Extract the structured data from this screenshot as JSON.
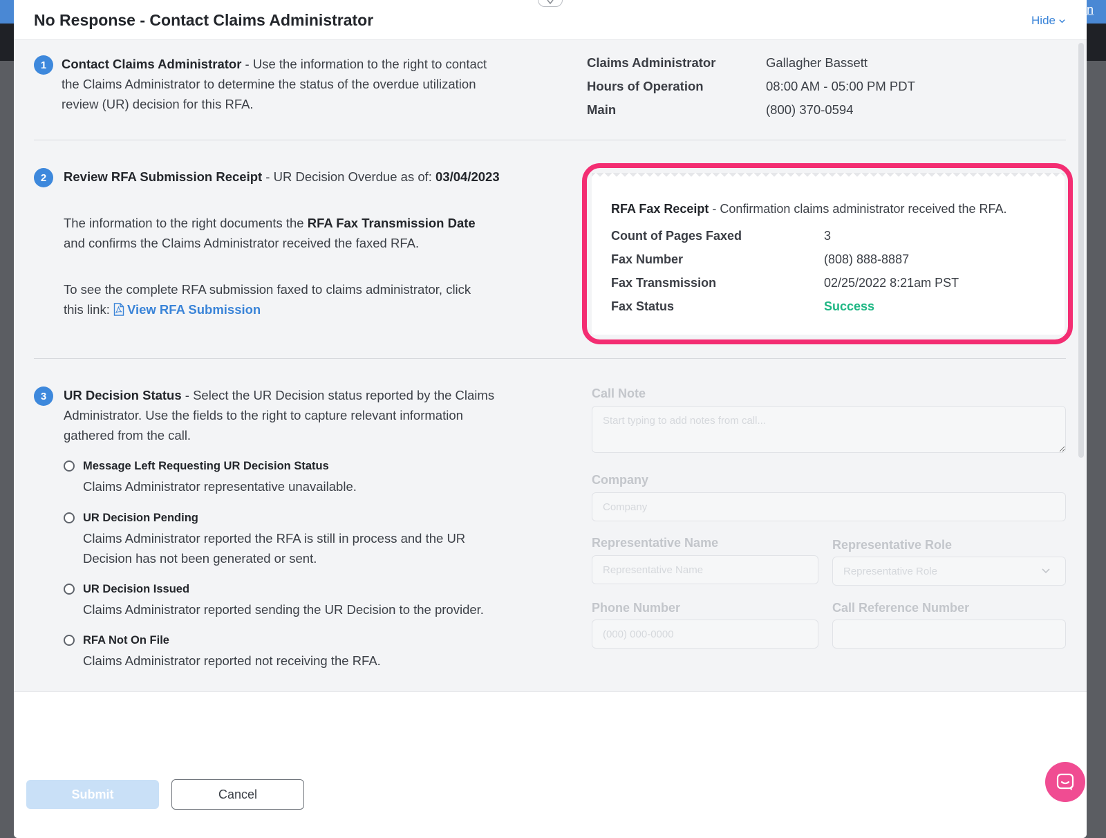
{
  "background": {
    "corner_link": "n"
  },
  "modal": {
    "title": "No Response - Contact Claims Administrator",
    "hide_label": "Hide"
  },
  "step1": {
    "number": "1",
    "heading": "Contact Claims Administrator",
    "text_line1": " - Use the information to the right to contact",
    "text_line2": "the Claims Administrator to determine the status of the overdue utilization",
    "text_line3": "review (UR) decision for this RFA.",
    "info": [
      {
        "label": "Claims Administrator",
        "value": "Gallagher Bassett"
      },
      {
        "label": "Hours of Operation",
        "value": "08:00 AM - 05:00 PM PDT"
      },
      {
        "label": "Main",
        "value": "(800) 370-0594"
      }
    ]
  },
  "step2": {
    "number": "2",
    "heading": "Review RFA Submission Receipt",
    "overdue_prefix": " - UR Decision Overdue as of: ",
    "overdue_date": "03/04/2023",
    "p1_a": "The information to the right documents the ",
    "p1_b": "RFA Fax Transmission Date",
    "p1_c": "and confirms the Claims Administrator received the faxed RFA.",
    "p2_a": "To see the complete RFA submission faxed to claims administrator, click",
    "p2_b": "this link: ",
    "link_label": "View RFA Submission",
    "receipt": {
      "title": "RFA Fax Receipt",
      "subtitle": " - Confirmation claims administrator received the RFA.",
      "rows": [
        {
          "label": "Count of Pages Faxed",
          "value": "3"
        },
        {
          "label": "Fax Number",
          "value": "(808) 888-8887"
        },
        {
          "label": "Fax Transmission",
          "value": "02/25/2022 8:21am PST"
        },
        {
          "label": "Fax Status",
          "value": "Success"
        }
      ],
      "status_color": "#1fb784",
      "highlight_color": "#f32d72"
    }
  },
  "step3": {
    "number": "3",
    "heading": "UR Decision Status",
    "text_line1": " - Select the UR Decision status reported by the Claims",
    "text_line2": "Administrator. Use the fields to the right to capture relevant information",
    "text_line3": "gathered from the call.",
    "options": [
      {
        "title": "Message Left Requesting UR Decision Status",
        "desc1": "Claims Administrator representative unavailable.",
        "desc2": ""
      },
      {
        "title": "UR Decision Pending",
        "desc1": "Claims Administrator reported the RFA is still in process and the UR",
        "desc2": "Decision has not been generated or sent."
      },
      {
        "title": "UR Decision Issued",
        "desc1": "Claims Administrator reported sending the UR Decision to the provider.",
        "desc2": ""
      },
      {
        "title": "RFA Not On File",
        "desc1": "Claims Administrator reported not receiving the RFA.",
        "desc2": ""
      }
    ],
    "form": {
      "call_note_label": "Call Note",
      "call_note_placeholder": "Start typing to add notes from call...",
      "company_label": "Company",
      "company_placeholder": "Company",
      "rep_name_label": "Representative Name",
      "rep_name_placeholder": "Representative Name",
      "rep_role_label": "Representative Role",
      "rep_role_placeholder": "Representative Role",
      "phone_label": "Phone Number",
      "phone_placeholder": "(000) 000-0000",
      "call_ref_label": "Call Reference Number",
      "call_ref_placeholder": ""
    }
  },
  "footer": {
    "submit_label": "Submit",
    "cancel_label": "Cancel"
  },
  "colors": {
    "accent": "#3d88dc",
    "link": "#3a84d8",
    "chat": "#f04c92"
  }
}
